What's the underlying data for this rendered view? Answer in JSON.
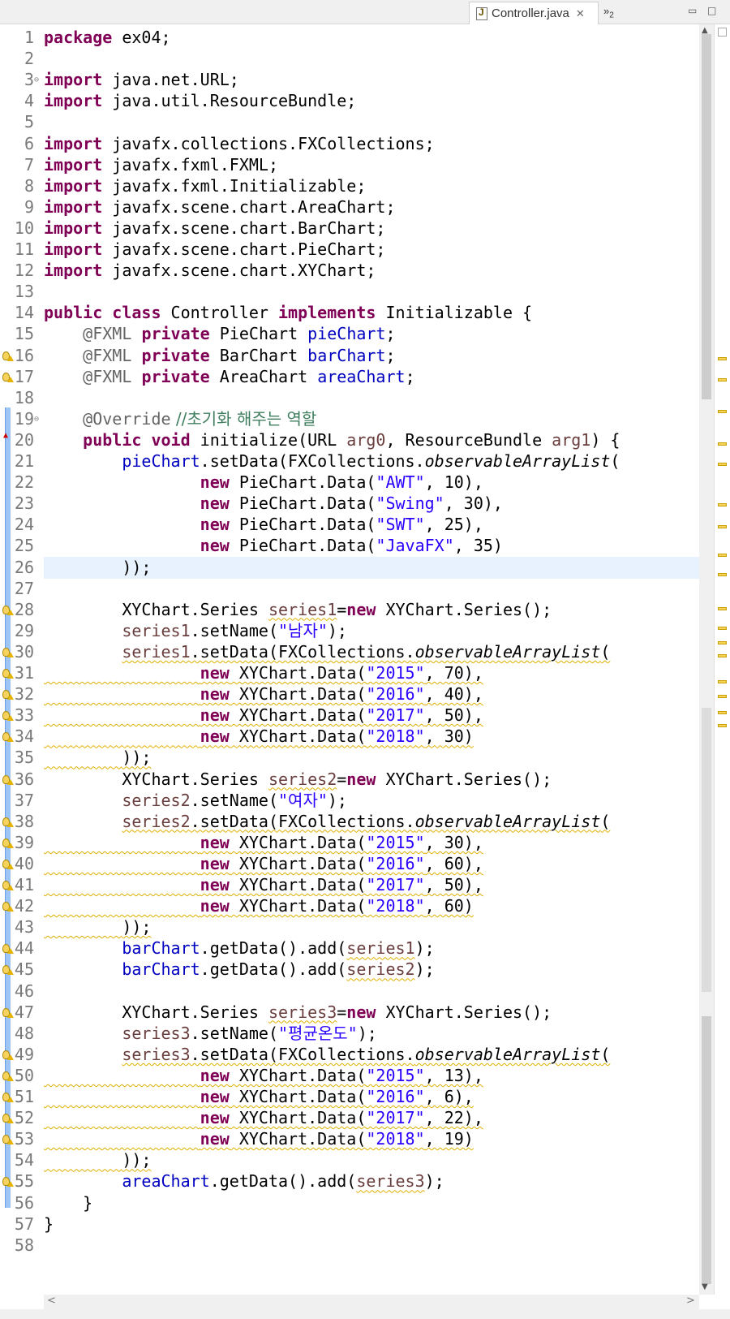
{
  "tab": {
    "title": "Controller.java",
    "close_icon": "close-icon",
    "overflow": "»",
    "overflow_count": "2"
  },
  "window": {
    "minimize": "▭",
    "maximize": "□"
  },
  "scroll": {
    "up": "▲",
    "down": "▼",
    "left": "<",
    "right": ">"
  },
  "line_numbers": [
    "1",
    "2",
    "3",
    "4",
    "5",
    "6",
    "7",
    "8",
    "9",
    "10",
    "11",
    "12",
    "13",
    "14",
    "15",
    "16",
    "17",
    "18",
    "19",
    "20",
    "21",
    "22",
    "23",
    "24",
    "25",
    "26",
    "27",
    "28",
    "29",
    "30",
    "31",
    "32",
    "33",
    "34",
    "35",
    "36",
    "37",
    "38",
    "39",
    "40",
    "41",
    "42",
    "43",
    "44",
    "45",
    "46",
    "47",
    "48",
    "49",
    "50",
    "51",
    "52",
    "53",
    "54",
    "55",
    "56",
    "57",
    "58"
  ],
  "code": {
    "l1": {
      "kw": "package",
      "rest": " ex04;"
    },
    "l3": {
      "kw": "import",
      "rest": " java.net.URL;"
    },
    "l4": {
      "kw": "import",
      "rest": " java.util.ResourceBundle;"
    },
    "l6": {
      "kw": "import",
      "rest": " javafx.collections.FXCollections;"
    },
    "l7": {
      "kw": "import",
      "rest": " javafx.fxml.FXML;"
    },
    "l8": {
      "kw": "import",
      "rest": " javafx.fxml.Initializable;"
    },
    "l9": {
      "kw": "import",
      "rest": " javafx.scene.chart.AreaChart;"
    },
    "l10": {
      "kw": "import",
      "rest": " javafx.scene.chart.BarChart;"
    },
    "l11": {
      "kw": "import",
      "rest": " javafx.scene.chart.PieChart;"
    },
    "l12": {
      "kw": "import",
      "rest": " javafx.scene.chart.XYChart;"
    },
    "l14": {
      "kw1": "public",
      "kw2": "class",
      "name": " Controller ",
      "kw3": "implements",
      "rest": " Initializable {"
    },
    "fxml": "@FXML",
    "private": "private",
    "l15": {
      "type": " PieChart ",
      "field": "pieChart",
      "end": ";"
    },
    "l16": {
      "type": " BarChart ",
      "field": "barChart",
      "end": ";"
    },
    "l17": {
      "type": " AreaChart ",
      "field": "areaChart",
      "end": ";"
    },
    "l19": {
      "ann": "@Override",
      "cmt": " //초기화 해주는 역할"
    },
    "l20": {
      "kw1": "public",
      "kw2": "void",
      "a": " initialize(URL ",
      "p1": "arg0",
      "b": ", ResourceBundle ",
      "p2": "arg1",
      "c": ") {"
    },
    "l21": {
      "field": "pieChart",
      "a": ".setData(FXCollections.",
      "it": "observableArrayList",
      "b": "("
    },
    "new": "new",
    "pie": [
      {
        "a": " PieChart.Data(",
        "s": "\"AWT\"",
        "b": ", 10),"
      },
      {
        "a": " PieChart.Data(",
        "s": "\"Swing\"",
        "b": ", 30),"
      },
      {
        "a": " PieChart.Data(",
        "s": "\"SWT\"",
        "b": ", 25),"
      },
      {
        "a": " PieChart.Data(",
        "s": "\"JavaFX\"",
        "b": ", 35)"
      }
    ],
    "close_call": "));",
    "series_decl": [
      {
        "a": "XYChart.Series ",
        "v": "series1",
        "b": "=",
        "c": " XYChart.Series();"
      },
      {
        "a": "XYChart.Series ",
        "v": "series2",
        "b": "=",
        "c": " XYChart.Series();"
      },
      {
        "a": "XYChart.Series ",
        "v": "series3",
        "b": "=",
        "c": " XYChart.Series();"
      }
    ],
    "set_name": [
      {
        "v": "series1",
        "a": ".setName(",
        "s": "\"남자\"",
        "b": ");"
      },
      {
        "v": "series2",
        "a": ".setName(",
        "s": "\"여자\"",
        "b": ");"
      },
      {
        "v": "series3",
        "a": ".setName(",
        "s": "\"평균온도\"",
        "b": ");"
      }
    ],
    "set_data": [
      {
        "v": "series1",
        "a": ".setData(FXCollections.",
        "it": "observableArrayList",
        "b": "("
      },
      {
        "v": "series2",
        "a": ".setData(FXCollections.",
        "it": "observableArrayList",
        "b": "("
      },
      {
        "v": "series3",
        "a": ".setData(FXCollections.",
        "it": "observableArrayList",
        "b": "("
      }
    ],
    "xy_prefix": " XYChart.Data(",
    "s1": [
      {
        "s": "\"2015\"",
        "b": ", 70),"
      },
      {
        "s": "\"2016\"",
        "b": ", 40),"
      },
      {
        "s": "\"2017\"",
        "b": ", 50),"
      },
      {
        "s": "\"2018\"",
        "b": ", 30)"
      }
    ],
    "s2": [
      {
        "s": "\"2015\"",
        "b": ", 30),"
      },
      {
        "s": "\"2016\"",
        "b": ", 60),"
      },
      {
        "s": "\"2017\"",
        "b": ", 50),"
      },
      {
        "s": "\"2018\"",
        "b": ", 60)"
      }
    ],
    "s3": [
      {
        "s": "\"2015\"",
        "b": ", 13),"
      },
      {
        "s": "\"2016\"",
        "b": ", 6),"
      },
      {
        "s": "\"2017\"",
        "b": ", 22),"
      },
      {
        "s": "\"2018\"",
        "b": ", 19)"
      }
    ],
    "add": [
      {
        "f": "barChart",
        "a": ".getData().add(",
        "v": "series1",
        "b": ");"
      },
      {
        "f": "barChart",
        "a": ".getData().add(",
        "v": "series2",
        "b": ");"
      },
      {
        "f": "areaChart",
        "a": ".getData().add(",
        "v": "series3",
        "b": ");"
      }
    ],
    "close_method": "}",
    "close_class": "}"
  },
  "colors": {
    "keyword": "#7f0055",
    "string": "#2a00ff",
    "field": "#0000c0",
    "comment": "#3f7f5f",
    "annotation": "#646464",
    "current_line": "#e8f2fe"
  }
}
